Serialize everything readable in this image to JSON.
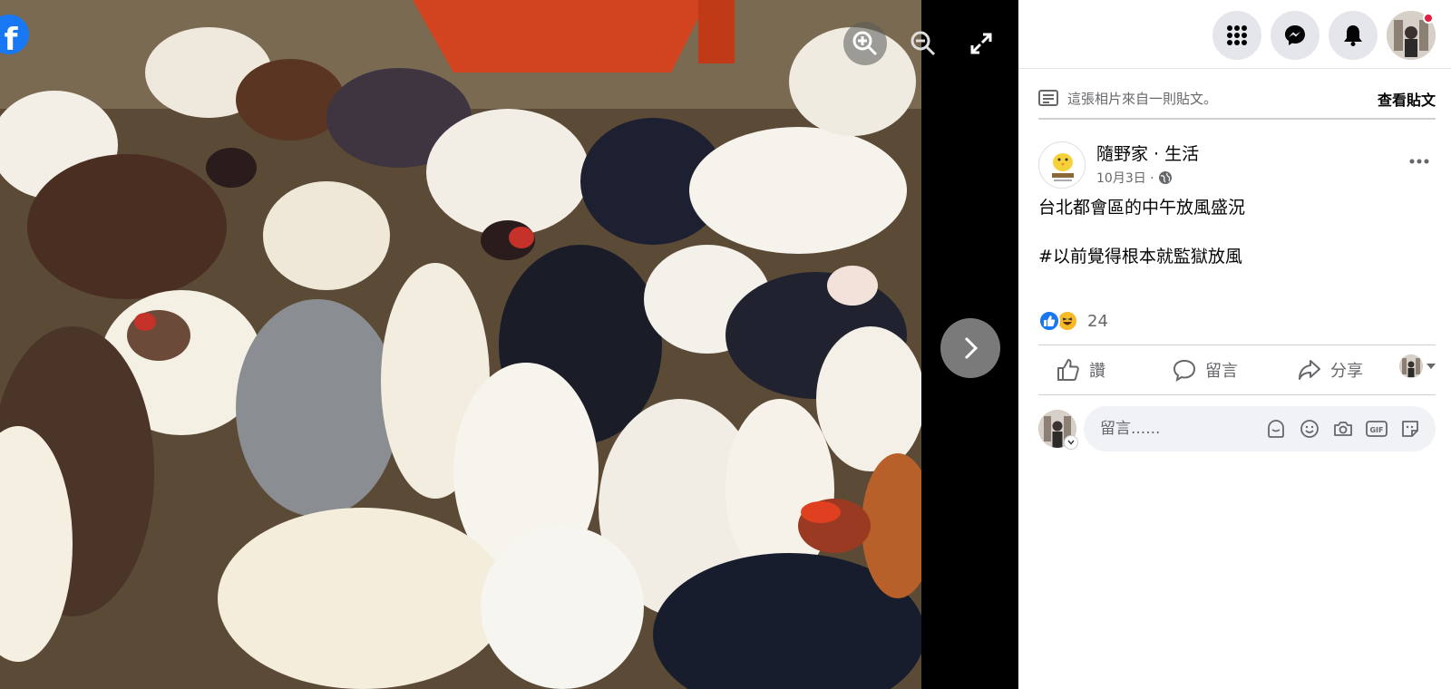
{
  "viewer": {
    "photo_alt": "雞群照片",
    "brand_logo": "f",
    "icons": [
      "zoom-in-icon",
      "zoom-out-icon",
      "fullscreen-icon",
      "chevron-right-icon"
    ]
  },
  "topbar": {
    "icons": [
      "grid-menu-icon",
      "messenger-icon",
      "bell-icon",
      "profile-avatar"
    ],
    "notification_dot_color": "#e41e3f"
  },
  "origin": {
    "text": "這張相片來自一則貼文。",
    "view_post_label": "查看貼文"
  },
  "post": {
    "author": "隨野家 · 生活",
    "date": "10月3日 ·",
    "text_line1": "台北都會區的中午放風盛況",
    "text_line2": "#以前覺得根本就監獄放風",
    "reaction_count": "24"
  },
  "actions": {
    "like_label": "讚",
    "comment_label": "留言",
    "share_label": "分享"
  },
  "comment": {
    "placeholder": "留言......",
    "icons": [
      "sticker-avatar-icon",
      "emoji-icon",
      "camera-icon",
      "gif-icon",
      "sticker-icon"
    ]
  },
  "colors": {
    "brand_blue": "#1877f2",
    "secondary_text": "#65676b",
    "divider": "#ced0d4"
  }
}
